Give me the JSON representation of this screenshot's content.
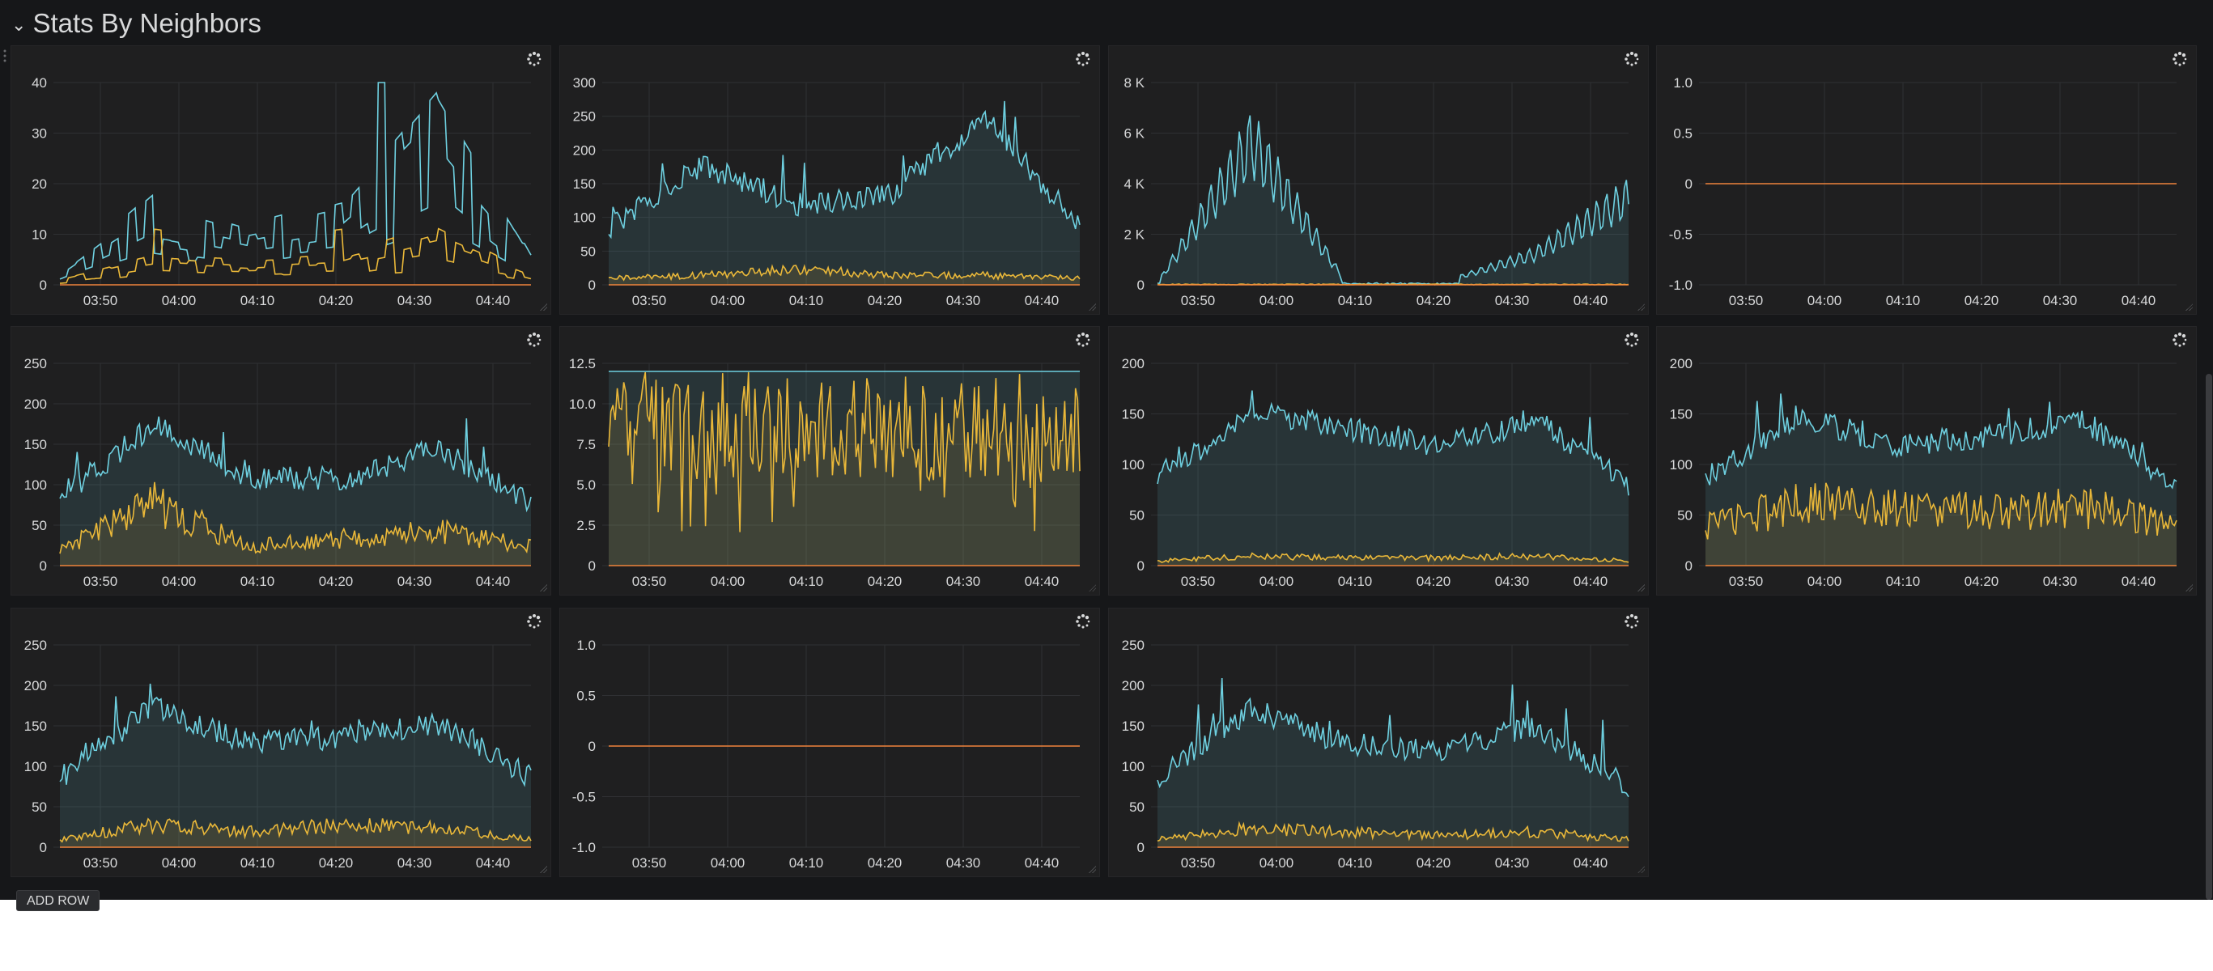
{
  "row": {
    "title": "Stats By Neighbors",
    "add_row_label": "ADD ROW"
  },
  "colors": {
    "cyan": "#6ed0e0",
    "yellow": "#eab839",
    "green": "#7eb26d",
    "orange": "#ef843c",
    "background": "#161719",
    "panel": "#1f1f20",
    "grid": "#2f3033",
    "text": "#d8d9da"
  },
  "x_ticks": [
    "03:50",
    "04:00",
    "04:10",
    "04:20",
    "04:30",
    "04:40"
  ],
  "panels": [
    {
      "title": "",
      "y_ticks": [
        "0",
        "10",
        "20",
        "30",
        "40"
      ],
      "ylim": [
        0,
        40
      ],
      "style": "step",
      "series_colors": [
        "#6ed0e0",
        "#eab839"
      ]
    },
    {
      "title": "",
      "y_ticks": [
        "0",
        "50",
        "100",
        "150",
        "200",
        "250",
        "300"
      ],
      "ylim": [
        0,
        300
      ],
      "style": "noisy",
      "series_colors": [
        "#6ed0e0",
        "#eab839",
        "#7eb26d"
      ]
    },
    {
      "title": "",
      "y_ticks": [
        "0",
        "2 K",
        "4 K",
        "6 K",
        "8 K"
      ],
      "ylim": [
        0,
        8000
      ],
      "style": "spikes",
      "series_colors": [
        "#6ed0e0",
        "#eab839"
      ]
    },
    {
      "title": "",
      "y_ticks": [
        "-1.0",
        "-0.5",
        "0",
        "0.5",
        "1.0"
      ],
      "ylim": [
        -1,
        1
      ],
      "style": "flat",
      "series_colors": [
        "#ef843c"
      ]
    },
    {
      "title": "",
      "y_ticks": [
        "0",
        "50",
        "100",
        "150",
        "200",
        "250"
      ],
      "ylim": [
        0,
        250
      ],
      "style": "noisy",
      "series_colors": [
        "#6ed0e0",
        "#eab839",
        "#7eb26d"
      ]
    },
    {
      "title": "",
      "y_ticks": [
        "0",
        "2.5",
        "5.0",
        "7.5",
        "10.0",
        "12.5"
      ],
      "ylim": [
        0,
        12.5
      ],
      "style": "jagged",
      "series_colors": [
        "#6ed0e0",
        "#eab839"
      ]
    },
    {
      "title": "",
      "y_ticks": [
        "0",
        "50",
        "100",
        "150",
        "200"
      ],
      "ylim": [
        0,
        200
      ],
      "style": "noisy",
      "series_colors": [
        "#6ed0e0",
        "#eab839",
        "#7eb26d"
      ]
    },
    {
      "title": "",
      "y_ticks": [
        "0",
        "50",
        "100",
        "150",
        "200"
      ],
      "ylim": [
        0,
        200
      ],
      "style": "mid",
      "series_colors": [
        "#6ed0e0",
        "#eab839",
        "#7eb26d"
      ]
    },
    {
      "title": "",
      "y_ticks": [
        "0",
        "50",
        "100",
        "150",
        "200",
        "250"
      ],
      "ylim": [
        0,
        250
      ],
      "style": "noisy",
      "series_colors": [
        "#6ed0e0",
        "#eab839",
        "#7eb26d"
      ]
    },
    {
      "title": "",
      "y_ticks": [
        "-1.0",
        "-0.5",
        "0",
        "0.5",
        "1.0"
      ],
      "ylim": [
        -1,
        1
      ],
      "style": "flat",
      "series_colors": [
        "#ef843c"
      ]
    },
    {
      "title": "",
      "y_ticks": [
        "0",
        "50",
        "100",
        "150",
        "200",
        "250"
      ],
      "ylim": [
        0,
        250
      ],
      "style": "noisy",
      "series_colors": [
        "#6ed0e0",
        "#eab839",
        "#7eb26d"
      ]
    }
  ],
  "chart_data": [
    {
      "type": "line",
      "x": [
        "03:50",
        "04:00",
        "04:10",
        "04:20",
        "04:30",
        "04:40"
      ],
      "ylim": [
        0,
        40
      ],
      "series": [
        {
          "values": [
            2,
            15,
            10,
            14,
            33,
            5
          ]
        },
        {
          "values": [
            1,
            5,
            4,
            5,
            10,
            2
          ]
        }
      ]
    },
    {
      "type": "area",
      "x": [
        "03:50",
        "04:00",
        "04:10",
        "04:20",
        "04:30",
        "04:40"
      ],
      "ylim": [
        0,
        300
      ],
      "series": [
        {
          "values": [
            100,
            210,
            140,
            160,
            290,
            100
          ]
        },
        {
          "values": [
            10,
            15,
            25,
            15,
            15,
            10
          ]
        }
      ]
    },
    {
      "type": "area",
      "x": [
        "03:50",
        "04:00",
        "04:10",
        "04:20",
        "04:30",
        "04:40"
      ],
      "ylim": [
        0,
        8000
      ],
      "series": [
        {
          "values": [
            100,
            7000,
            100,
            100,
            1500,
            4300
          ]
        },
        {
          "values": [
            50,
            50,
            50,
            50,
            50,
            50
          ]
        }
      ]
    },
    {
      "type": "line",
      "x": [
        "03:50",
        "04:00",
        "04:10",
        "04:20",
        "04:30",
        "04:40"
      ],
      "ylim": [
        -1,
        1
      ],
      "series": [
        {
          "values": [
            0,
            0,
            0,
            0,
            0,
            0
          ]
        }
      ]
    },
    {
      "type": "area",
      "x": [
        "03:50",
        "04:00",
        "04:10",
        "04:20",
        "04:30",
        "04:40"
      ],
      "ylim": [
        0,
        250
      ],
      "series": [
        {
          "values": [
            100,
            205,
            130,
            125,
            170,
            90
          ]
        },
        {
          "values": [
            20,
            80,
            25,
            35,
            45,
            25
          ]
        }
      ]
    },
    {
      "type": "area",
      "x": [
        "03:50",
        "04:00",
        "04:10",
        "04:20",
        "04:30",
        "04:40"
      ],
      "ylim": [
        0,
        12.5
      ],
      "series": [
        {
          "values": [
            12,
            12,
            12,
            12,
            12,
            12
          ]
        },
        {
          "values": [
            10,
            2,
            12,
            8,
            9,
            10
          ]
        }
      ]
    },
    {
      "type": "area",
      "x": [
        "03:50",
        "04:00",
        "04:10",
        "04:20",
        "04:30",
        "04:40"
      ],
      "ylim": [
        0,
        200
      ],
      "series": [
        {
          "values": [
            100,
            180,
            160,
            140,
            170,
            95
          ]
        },
        {
          "values": [
            5,
            10,
            8,
            8,
            10,
            5
          ]
        }
      ]
    },
    {
      "type": "area",
      "x": [
        "03:50",
        "04:00",
        "04:10",
        "04:20",
        "04:30",
        "04:40"
      ],
      "ylim": [
        0,
        200
      ],
      "series": [
        {
          "values": [
            100,
            175,
            140,
            150,
            170,
            90
          ]
        },
        {
          "values": [
            40,
            65,
            60,
            55,
            60,
            45
          ]
        }
      ]
    },
    {
      "type": "area",
      "x": [
        "03:50",
        "04:00",
        "04:10",
        "04:20",
        "04:30",
        "04:40"
      ],
      "ylim": [
        0,
        250
      ],
      "series": [
        {
          "values": [
            100,
            205,
            150,
            160,
            180,
            100
          ]
        },
        {
          "values": [
            10,
            30,
            20,
            30,
            25,
            10
          ]
        }
      ]
    },
    {
      "type": "line",
      "x": [
        "03:50",
        "04:00",
        "04:10",
        "04:20",
        "04:30",
        "04:40"
      ],
      "ylim": [
        -1,
        1
      ],
      "series": [
        {
          "values": [
            0,
            0,
            0,
            0,
            0,
            0
          ]
        }
      ]
    },
    {
      "type": "area",
      "x": [
        "03:50",
        "04:00",
        "04:10",
        "04:20",
        "04:30",
        "04:40"
      ],
      "ylim": [
        0,
        250
      ],
      "series": [
        {
          "values": [
            100,
            200,
            150,
            140,
            175,
            90
          ]
        },
        {
          "values": [
            10,
            25,
            20,
            15,
            20,
            10
          ]
        }
      ]
    }
  ]
}
